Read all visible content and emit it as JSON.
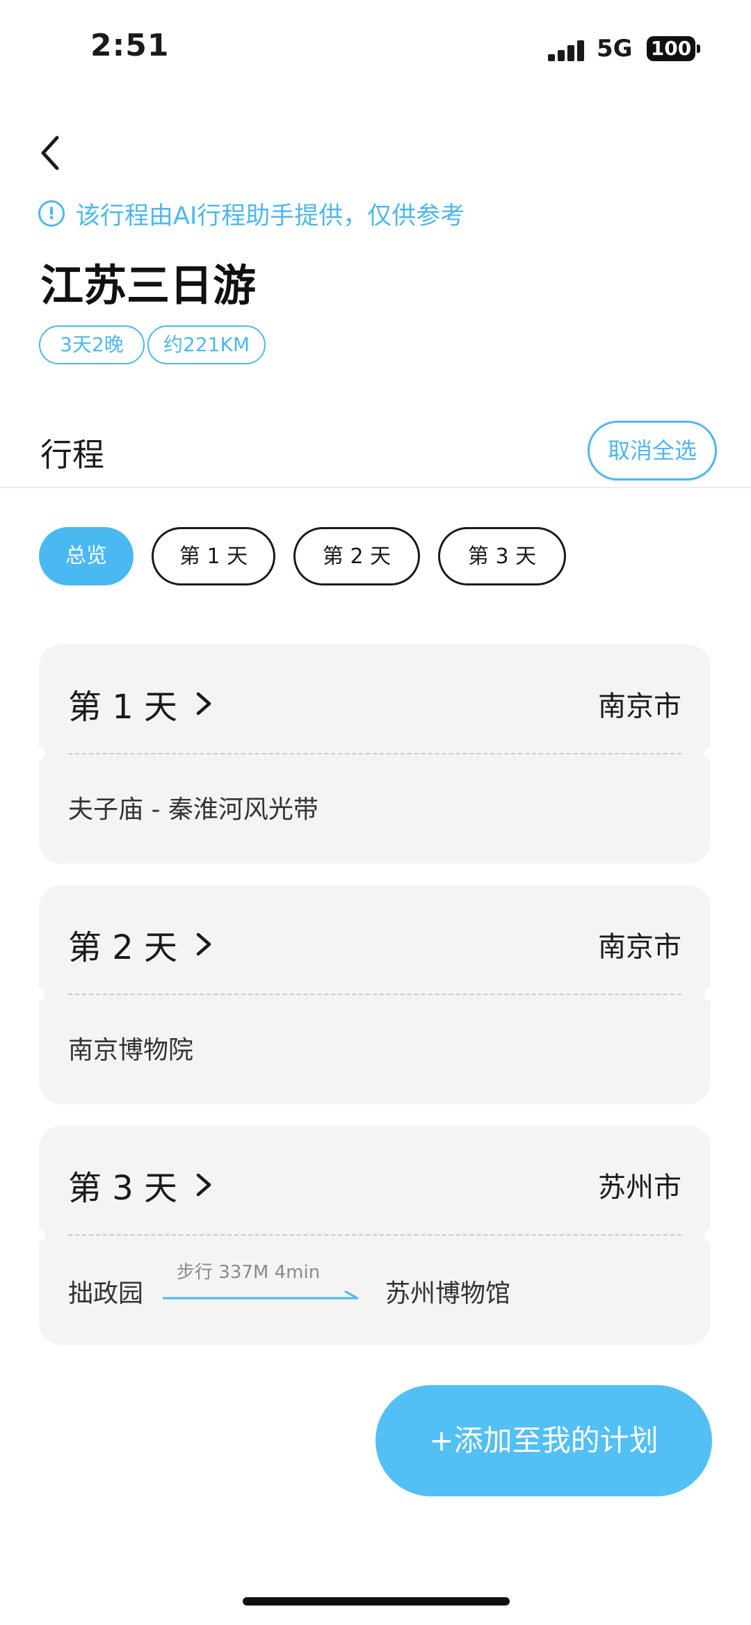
{
  "status_bar": {
    "time": "2:51",
    "network": "5G",
    "battery": "100"
  },
  "header": {
    "notice": "该行程由AI行程助手提供，仅供参考",
    "title": "江苏三日游",
    "tags": [
      "3天2晚",
      "约221KM"
    ]
  },
  "section": {
    "title": "行程",
    "deselect_label": "取消全选"
  },
  "tabs": [
    {
      "label": "总览",
      "active": true
    },
    {
      "label": "第 1 天",
      "active": false
    },
    {
      "label": "第 2 天",
      "active": false
    },
    {
      "label": "第 3 天",
      "active": false
    }
  ],
  "days": [
    {
      "day": "第 1 天",
      "city": "南京市",
      "spots": "夫子庙 - 秦淮河风光带"
    },
    {
      "day": "第 2 天",
      "city": "南京市",
      "spots": "南京博物院"
    },
    {
      "day": "第 3 天",
      "city": "苏州市",
      "from": "拙政园",
      "walk": "步行 337M 4min",
      "to": "苏州博物馆"
    }
  ],
  "add_button": "+添加至我的计划",
  "colors": {
    "accent": "#4ab9f2",
    "card_bg": "#f4f4f4"
  },
  "icons": {
    "back": "chevron-left-icon",
    "notice": "info-circle-icon",
    "day_arrow": "chevron-right-icon"
  }
}
